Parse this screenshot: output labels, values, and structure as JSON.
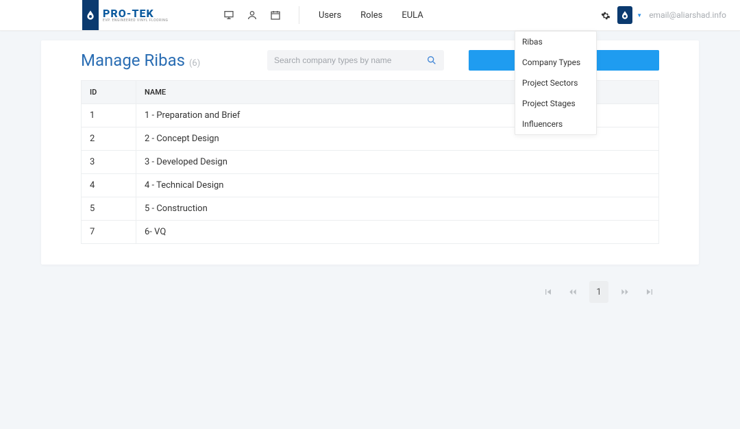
{
  "brand": {
    "name": "PRO-TEK",
    "tagline": "EVP. ENGINEERED VINYL FLOORING"
  },
  "nav": {
    "users": "Users",
    "roles": "Roles",
    "eula": "EULA"
  },
  "user": {
    "email": "email@aliarshad.info"
  },
  "dropdown": {
    "items": [
      "Ribas",
      "Company Types",
      "Project Sectors",
      "Project Stages",
      "Influencers"
    ]
  },
  "page": {
    "title": "Manage Ribas",
    "count": "(6)",
    "search_placeholder": "Search company types by name"
  },
  "table": {
    "headers": {
      "id": "ID",
      "name": "NAME"
    },
    "rows": [
      {
        "id": "1",
        "name": "1 - Preparation and Brief"
      },
      {
        "id": "2",
        "name": "2 - Concept Design"
      },
      {
        "id": "3",
        "name": "3 - Developed Design"
      },
      {
        "id": "4",
        "name": "4 - Technical Design"
      },
      {
        "id": "5",
        "name": "5 - Construction"
      },
      {
        "id": "7",
        "name": "6- VQ"
      }
    ]
  },
  "pager": {
    "page": "1"
  }
}
